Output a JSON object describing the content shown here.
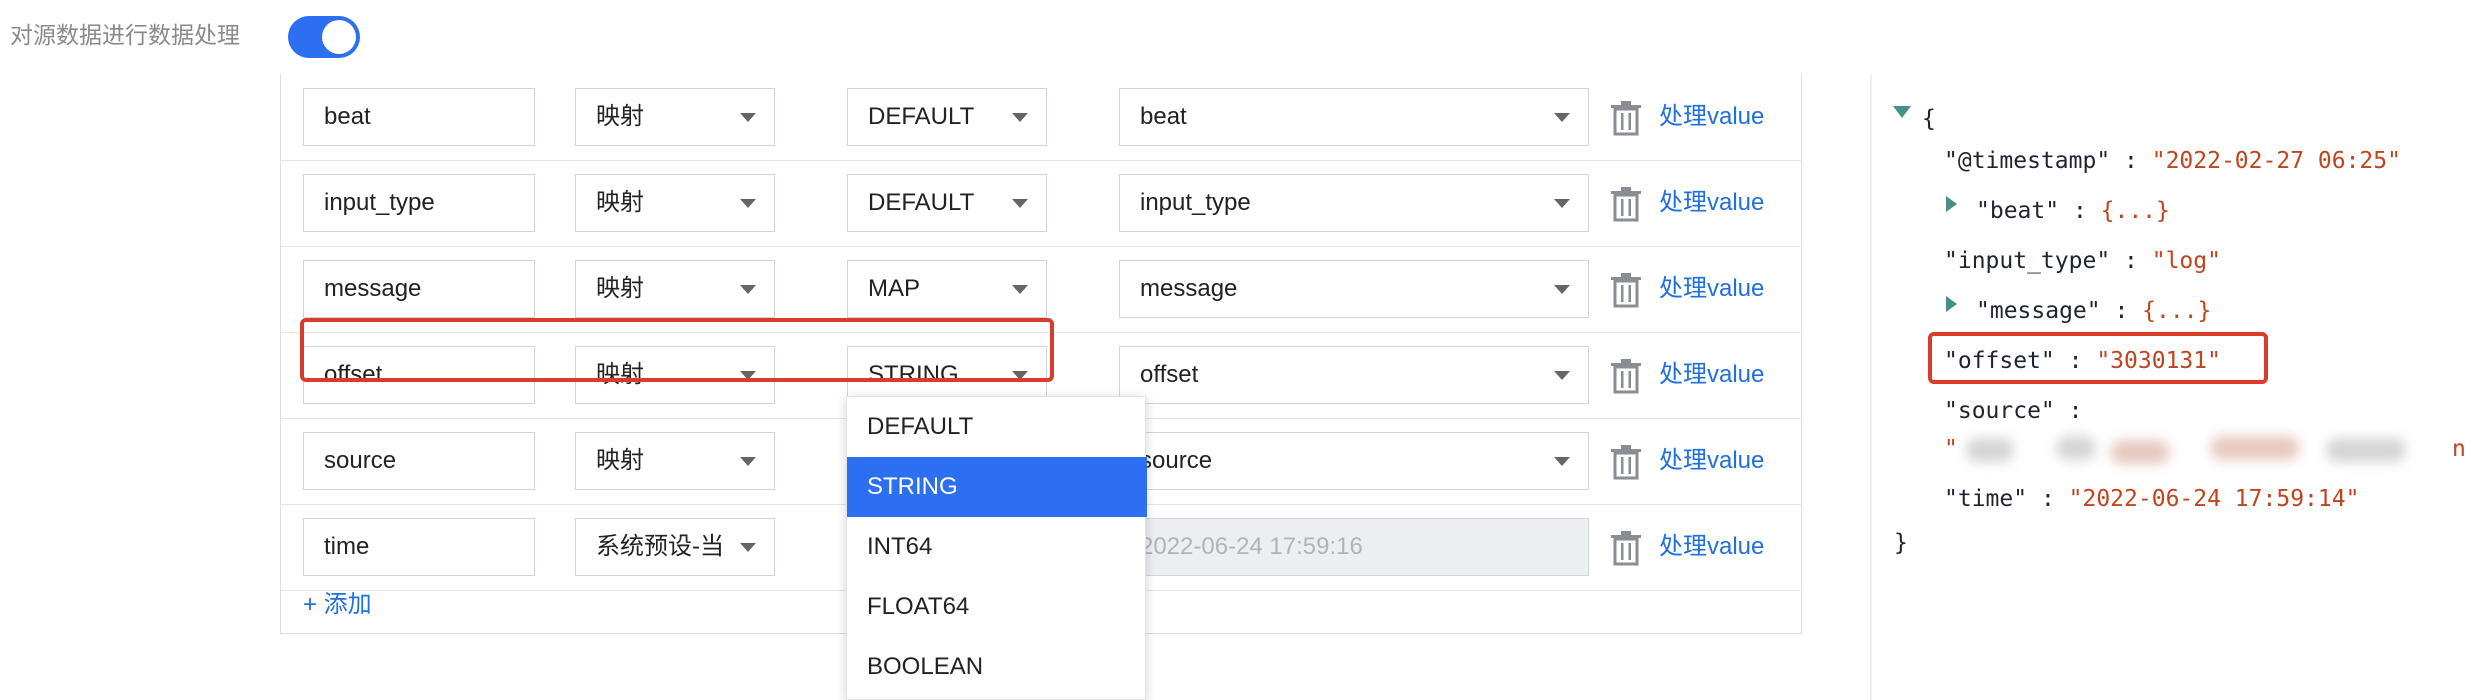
{
  "toggle": {
    "label": "对源数据进行数据处理",
    "enabled": true
  },
  "table": {
    "rows": [
      {
        "name": "beat",
        "mapping": "映射",
        "type": "DEFAULT",
        "target": "beat",
        "target_disabled": false,
        "action": "处理value"
      },
      {
        "name": "input_type",
        "mapping": "映射",
        "type": "DEFAULT",
        "target": "input_type",
        "target_disabled": false,
        "action": "处理value"
      },
      {
        "name": "message",
        "mapping": "映射",
        "type": "MAP",
        "target": "message",
        "target_disabled": false,
        "action": "处理value"
      },
      {
        "name": "offset",
        "mapping": "映射",
        "type": "STRING",
        "target": "offset",
        "target_disabled": false,
        "action": "处理value"
      },
      {
        "name": "source",
        "mapping": "映射",
        "type": "",
        "target": "source",
        "target_disabled": false,
        "action": "处理value"
      },
      {
        "name": "time",
        "mapping": "系统预设-当",
        "type": "",
        "target": "2022-06-24 17:59:16",
        "target_disabled": true,
        "action": "处理value"
      }
    ],
    "add_label": "+ 添加"
  },
  "type_dropdown": {
    "options": [
      "DEFAULT",
      "STRING",
      "INT64",
      "FLOAT64",
      "BOOLEAN"
    ],
    "selected": "STRING"
  },
  "json_preview": {
    "open_brace": "{",
    "close_brace": "}",
    "lines": [
      {
        "key": "\"@timestamp\"",
        "sep": " : ",
        "value": "\"2022-02-27 06:25\""
      },
      {
        "key": "\"beat\"",
        "sep": " : ",
        "value": "{...}",
        "collapsed": true
      },
      {
        "key": "\"input_type\"",
        "sep": " : ",
        "value": "\"log\""
      },
      {
        "key": "\"message\"",
        "sep": " : ",
        "value": "{...}",
        "collapsed": true
      },
      {
        "key": "\"offset\"",
        "sep": " : ",
        "value": "\"3030131\""
      },
      {
        "key": "\"source\"",
        "sep": " :",
        "value": ""
      },
      {
        "key": "\"time\"",
        "sep": " : ",
        "value": "\"2022-06-24 17:59:14\""
      }
    ],
    "source_value_prefix": "\"",
    "source_value_suffix": "n"
  },
  "colors": {
    "accent": "#2c6ff0",
    "link": "#1f6fe0",
    "highlight": "#d93c2a",
    "json_string": "#c0441e"
  }
}
